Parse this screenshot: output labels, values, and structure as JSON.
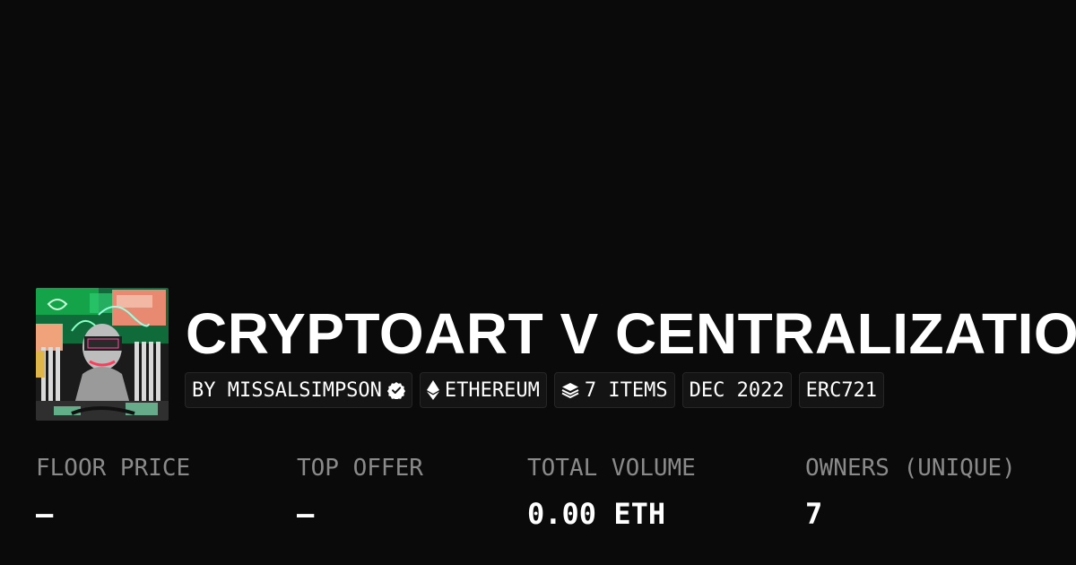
{
  "collection": {
    "title": "CRYPTOART V CENTRALIZATION",
    "thumbnail_icon": "collection-art-thumbnail"
  },
  "chips": {
    "creator": "BY MISSALSIMPSON",
    "chain": "ETHEREUM",
    "items": "7 ITEMS",
    "date": "DEC 2022",
    "standard": "ERC721"
  },
  "stats": {
    "floor_price": {
      "label": "FLOOR PRICE",
      "value": "–"
    },
    "top_offer": {
      "label": "TOP OFFER",
      "value": "–"
    },
    "total_volume": {
      "label": "TOTAL VOLUME",
      "value": "0.00 ETH"
    },
    "owners": {
      "label": "OWNERS (UNIQUE)",
      "value": "7"
    }
  },
  "colors": {
    "background": "#0a0a0a",
    "text": "#ffffff",
    "muted": "#8a8a8a",
    "chip_bg": "#141414",
    "chip_border": "#262626"
  },
  "icons": [
    "verified-badge-icon",
    "ethereum-icon",
    "layers-icon"
  ]
}
